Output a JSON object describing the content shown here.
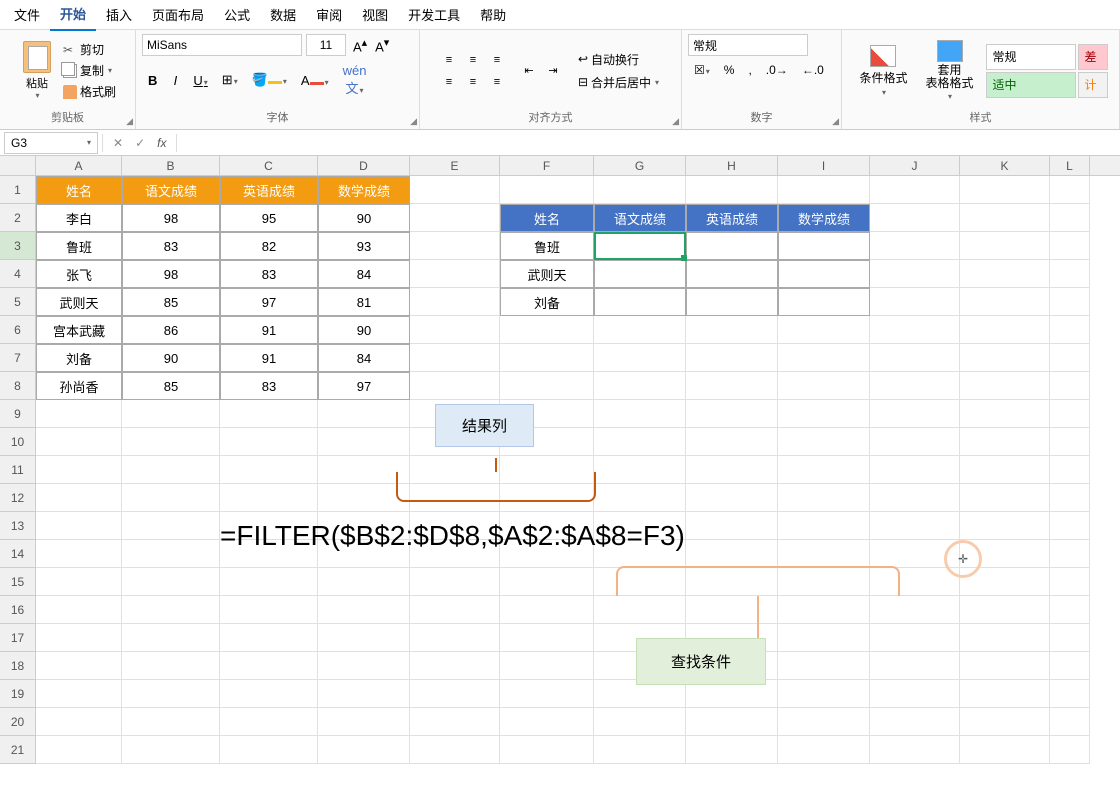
{
  "menubar": {
    "items": [
      "文件",
      "开始",
      "插入",
      "页面布局",
      "公式",
      "数据",
      "审阅",
      "视图",
      "开发工具",
      "帮助"
    ],
    "active_index": 1
  },
  "ribbon": {
    "clipboard": {
      "paste": "粘贴",
      "cut": "剪切",
      "copy": "复制",
      "format_painter": "格式刷",
      "group": "剪贴板"
    },
    "font": {
      "name": "MiSans",
      "size": "11",
      "wen": "文",
      "group": "字体"
    },
    "alignment": {
      "wrap": "自动换行",
      "merge": "合并后居中",
      "group": "对齐方式"
    },
    "number": {
      "format": "常规",
      "group": "数字"
    },
    "styles": {
      "cond": "条件格式",
      "table": "套用\n表格格式",
      "normal": "常规",
      "good": "适中",
      "bad": "差",
      "calc": "计",
      "group": "样式"
    }
  },
  "name_box": "G3",
  "columns": [
    "A",
    "B",
    "C",
    "D",
    "E",
    "F",
    "G",
    "H",
    "I",
    "J",
    "K",
    "L"
  ],
  "col_widths": [
    "wA",
    "wB",
    "wC",
    "wD",
    "wE",
    "wF",
    "wG",
    "wH",
    "wI",
    "wJ",
    "wK",
    "wL"
  ],
  "table1": {
    "headers": [
      "姓名",
      "语文成绩",
      "英语成绩",
      "数学成绩"
    ],
    "rows": [
      [
        "李白",
        "98",
        "95",
        "90"
      ],
      [
        "鲁班",
        "83",
        "82",
        "93"
      ],
      [
        "张飞",
        "98",
        "83",
        "84"
      ],
      [
        "武则天",
        "85",
        "97",
        "81"
      ],
      [
        "宫本武藏",
        "86",
        "91",
        "90"
      ],
      [
        "刘备",
        "90",
        "91",
        "84"
      ],
      [
        "孙尚香",
        "85",
        "83",
        "97"
      ]
    ]
  },
  "table2": {
    "headers": [
      "姓名",
      "语文成绩",
      "英语成绩",
      "数学成绩"
    ],
    "names": [
      "鲁班",
      "武则天",
      "刘备"
    ]
  },
  "annotations": {
    "result_col": "结果列",
    "lookup_cond": "查找条件",
    "formula": "=FILTER($B$2:$D$8,$A$2:$A$8=F3)"
  }
}
